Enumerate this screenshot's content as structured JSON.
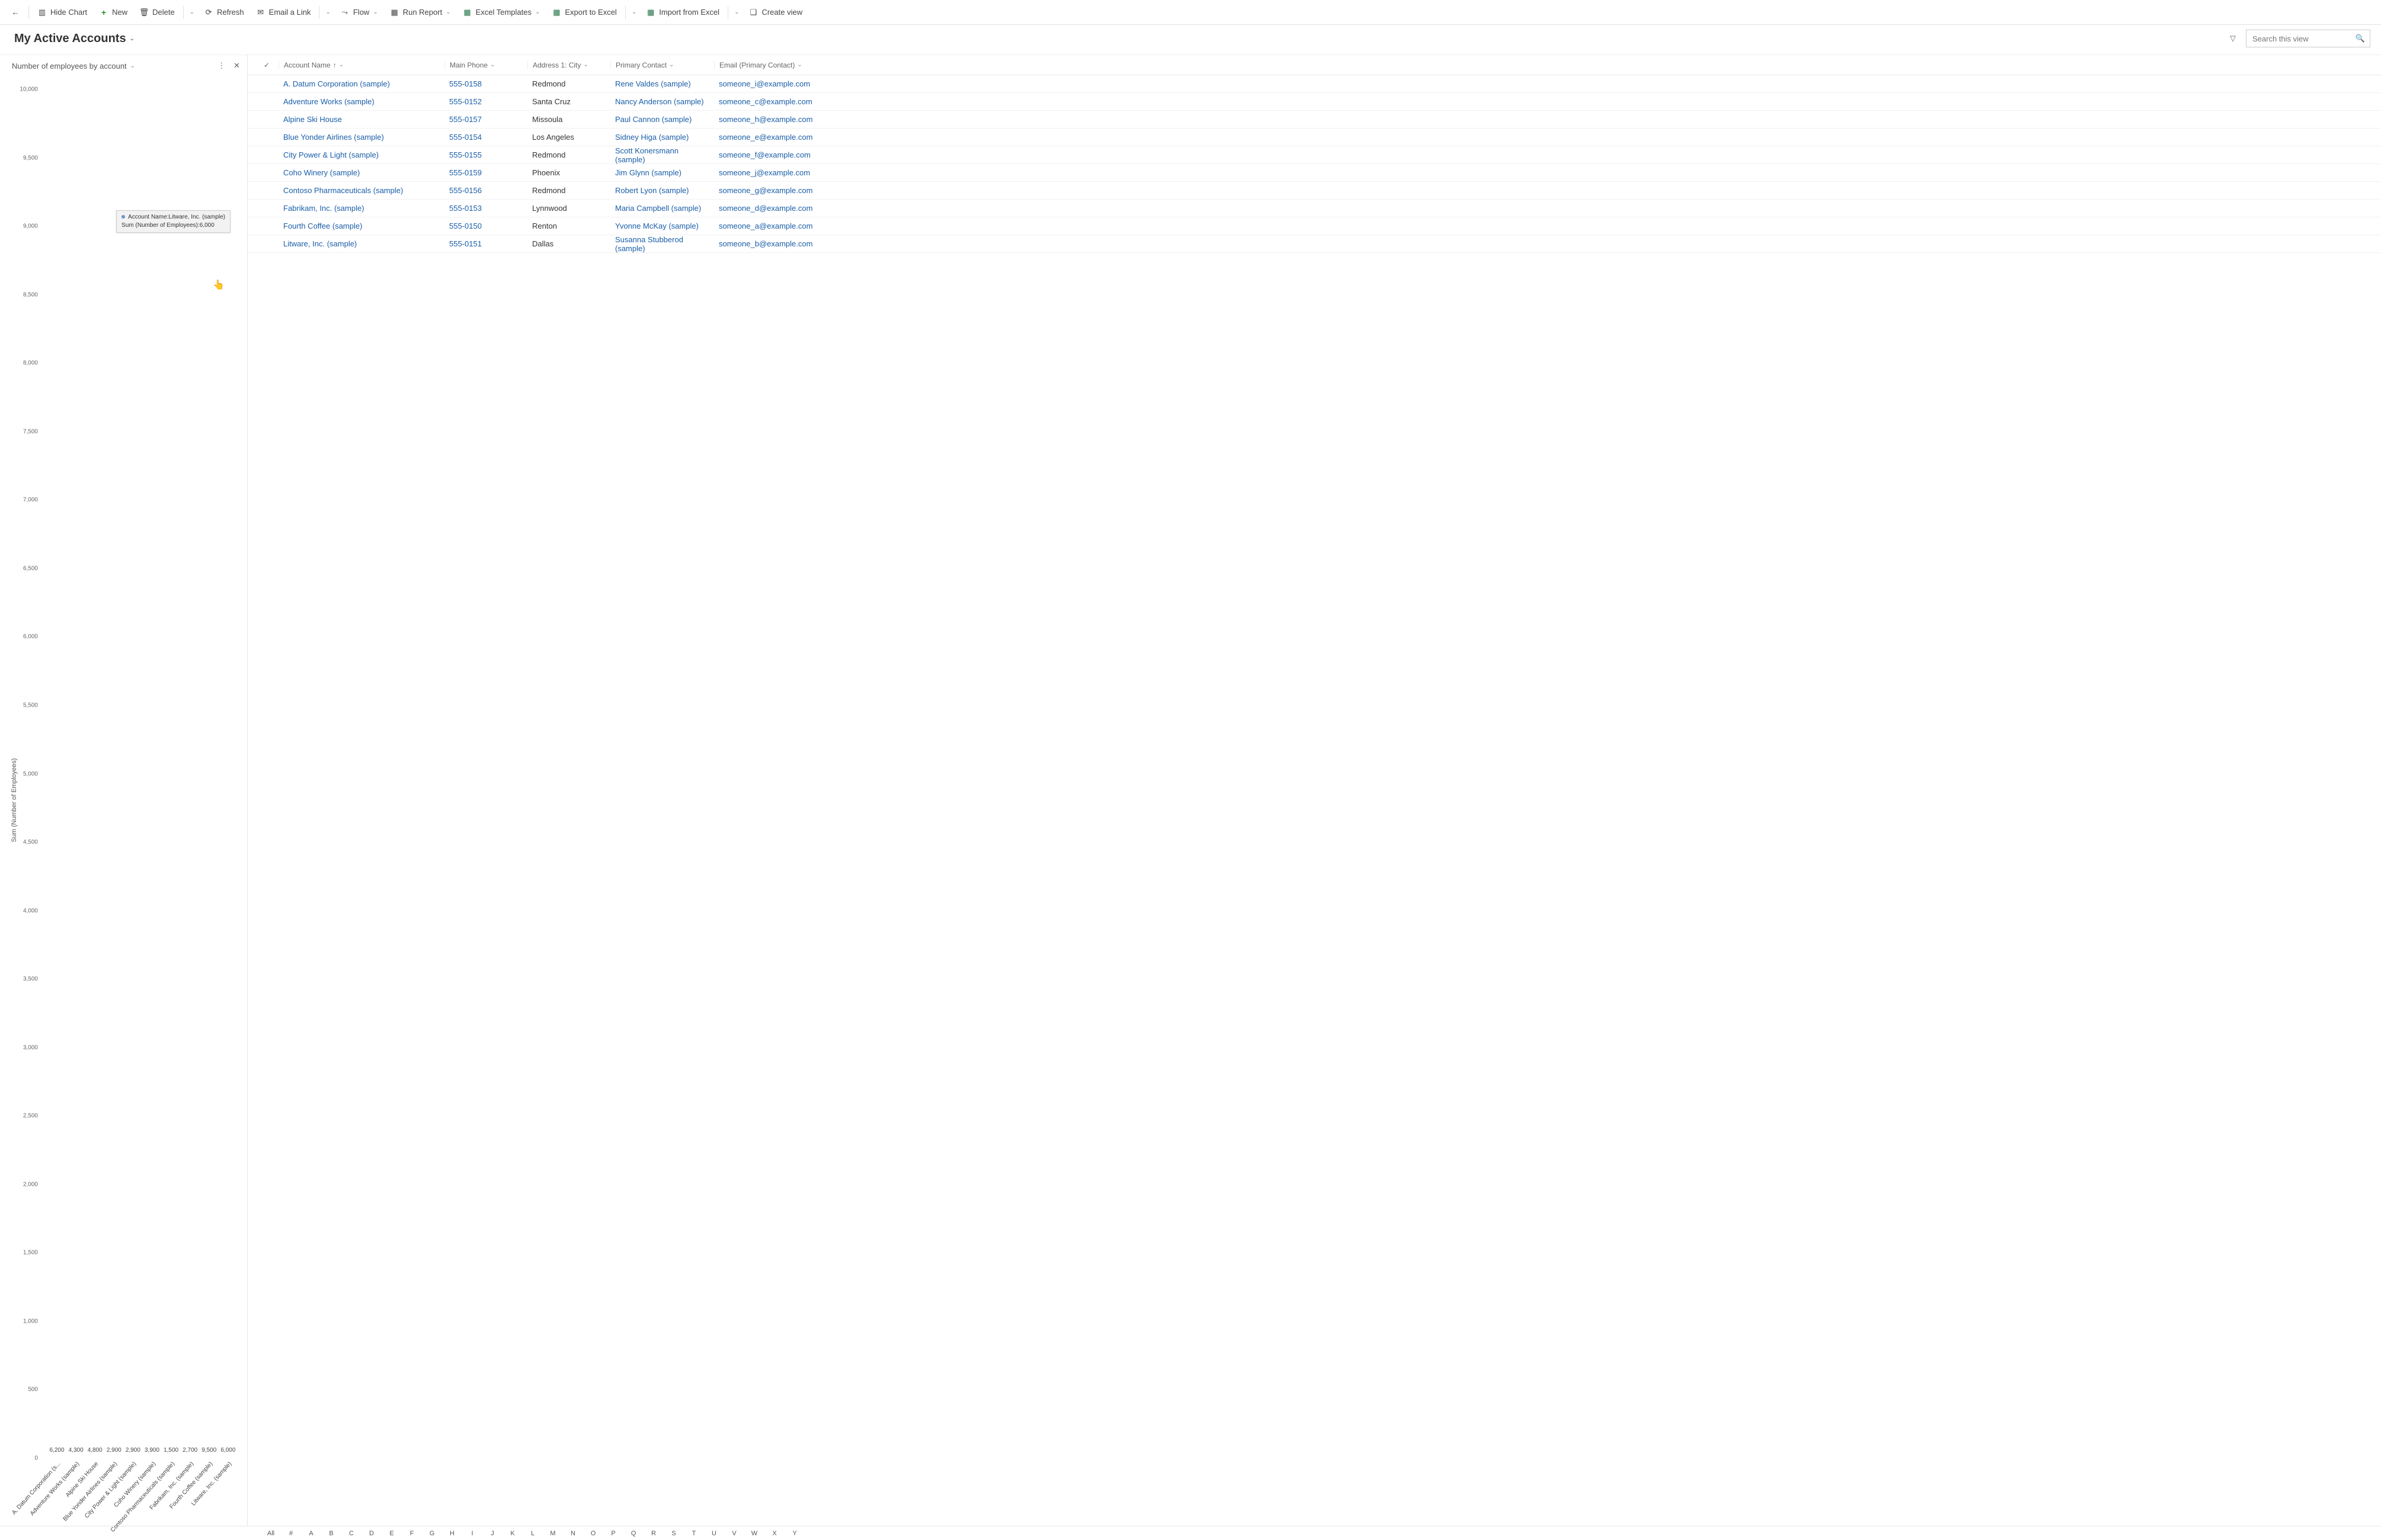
{
  "toolbar": {
    "hide_chart": "Hide Chart",
    "new": "New",
    "delete": "Delete",
    "refresh": "Refresh",
    "email_link": "Email a Link",
    "flow": "Flow",
    "run_report": "Run Report",
    "excel_templates": "Excel Templates",
    "export_excel": "Export to Excel",
    "import_excel": "Import from Excel",
    "create_view": "Create view"
  },
  "view": {
    "title": "My Active Accounts",
    "search_placeholder": "Search this view"
  },
  "chart_hdr": {
    "title": "Number of employees by account"
  },
  "chart_data": {
    "type": "bar",
    "title": "Number of employees by account",
    "ylabel": "Sum (Number of Employees)",
    "xlabel": "",
    "ylim": [
      0,
      10000
    ],
    "yticks": [
      0,
      500,
      1000,
      1500,
      2000,
      2500,
      3000,
      3500,
      4000,
      4500,
      5000,
      5500,
      6000,
      6500,
      7000,
      7500,
      8000,
      8500,
      9000,
      9500,
      10000
    ],
    "categories": [
      "A. Datum Corporation (s...",
      "Adventure Works (sample)",
      "Alpine Ski House",
      "Blue Yonder Airlines (sample)",
      "City Power & Light (sample)",
      "Coho Winery (sample)",
      "Contoso Pharmaceuticals (sample)",
      "Fabrikam, Inc. (sample)",
      "Fourth Coffee (sample)",
      "Litware, Inc. (sample)"
    ],
    "values": [
      6200,
      4300,
      4800,
      2900,
      2900,
      3900,
      1500,
      2700,
      9500,
      6000
    ],
    "tooltip": {
      "line1": "Account Name:Litware, Inc. (sample)",
      "line2": "Sum (Number of Employees):6,000"
    }
  },
  "grid": {
    "headers": {
      "name": "Account Name",
      "phone": "Main Phone",
      "city": "Address 1: City",
      "contact": "Primary Contact",
      "email": "Email (Primary Contact)"
    },
    "rows": [
      {
        "name": "A. Datum Corporation (sample)",
        "phone": "555-0158",
        "city": "Redmond",
        "contact": "Rene Valdes (sample)",
        "email": "someone_i@example.com"
      },
      {
        "name": "Adventure Works (sample)",
        "phone": "555-0152",
        "city": "Santa Cruz",
        "contact": "Nancy Anderson (sample)",
        "email": "someone_c@example.com"
      },
      {
        "name": "Alpine Ski House",
        "phone": "555-0157",
        "city": "Missoula",
        "contact": "Paul Cannon (sample)",
        "email": "someone_h@example.com"
      },
      {
        "name": "Blue Yonder Airlines (sample)",
        "phone": "555-0154",
        "city": "Los Angeles",
        "contact": "Sidney Higa (sample)",
        "email": "someone_e@example.com"
      },
      {
        "name": "City Power & Light (sample)",
        "phone": "555-0155",
        "city": "Redmond",
        "contact": "Scott Konersmann (sample)",
        "email": "someone_f@example.com"
      },
      {
        "name": "Coho Winery (sample)",
        "phone": "555-0159",
        "city": "Phoenix",
        "contact": "Jim Glynn (sample)",
        "email": "someone_j@example.com"
      },
      {
        "name": "Contoso Pharmaceuticals (sample)",
        "phone": "555-0156",
        "city": "Redmond",
        "contact": "Robert Lyon (sample)",
        "email": "someone_g@example.com"
      },
      {
        "name": "Fabrikam, Inc. (sample)",
        "phone": "555-0153",
        "city": "Lynnwood",
        "contact": "Maria Campbell (sample)",
        "email": "someone_d@example.com"
      },
      {
        "name": "Fourth Coffee (sample)",
        "phone": "555-0150",
        "city": "Renton",
        "contact": "Yvonne McKay (sample)",
        "email": "someone_a@example.com"
      },
      {
        "name": "Litware, Inc. (sample)",
        "phone": "555-0151",
        "city": "Dallas",
        "contact": "Susanna Stubberod (sample)",
        "email": "someone_b@example.com"
      }
    ]
  },
  "alpha": [
    "All",
    "#",
    "A",
    "B",
    "C",
    "D",
    "E",
    "F",
    "G",
    "H",
    "I",
    "J",
    "K",
    "L",
    "M",
    "N",
    "O",
    "P",
    "Q",
    "R",
    "S",
    "T",
    "U",
    "V",
    "W",
    "X",
    "Y"
  ]
}
